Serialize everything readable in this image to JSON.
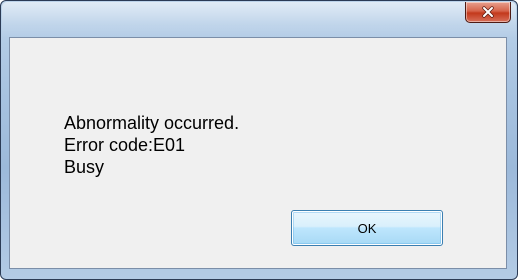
{
  "window": {
    "title": ""
  },
  "title_bar": {
    "close_icon": "close-icon"
  },
  "message": {
    "lines": [
      "Abnormality occurred.",
      "Error code:E01",
      "Busy"
    ]
  },
  "buttons": {
    "ok_label": "OK"
  },
  "colors": {
    "frame": "#a9c4e1",
    "close_button": "#c3391c",
    "client_background": "#f0f0f0",
    "ok_button_border": "#3c7fb1"
  }
}
